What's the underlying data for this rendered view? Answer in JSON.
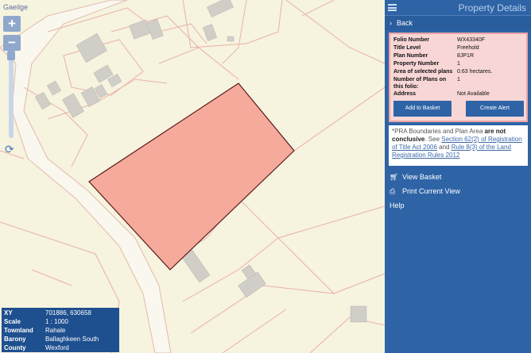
{
  "map": {
    "language_link": "Gaeilge",
    "zoom_in_label": "+",
    "zoom_out_label": "−",
    "selected_parcel_color": "#f5aa9c",
    "info": {
      "rows": [
        {
          "key": "XY",
          "value": "701886, 630658"
        },
        {
          "key": "Scale",
          "value": "1 : 1000"
        },
        {
          "key": "Townland",
          "value": "Rahale"
        },
        {
          "key": "Barony",
          "value": "Ballaghkeen South"
        },
        {
          "key": "County",
          "value": "Wexford"
        }
      ]
    }
  },
  "panel": {
    "title": "Property Details",
    "back_label": "Back",
    "details": [
      {
        "key": "Folio Number",
        "value": "WX43340F"
      },
      {
        "key": "Title Level",
        "value": "Freehold"
      },
      {
        "key": "Plan Number",
        "value": "8JP1R"
      },
      {
        "key": "Property Number",
        "value": "1"
      },
      {
        "key": "Area of selected plans",
        "value": "0.63 hectares."
      },
      {
        "key": "Number of Plans on this folio:",
        "value": "1"
      },
      {
        "key": "Address",
        "value": "Not Available"
      }
    ],
    "add_to_basket_label": "Add to Basket",
    "create_alert_label": "Create Alert",
    "note": {
      "prefix": "*PRA Boundaries and Plan Area ",
      "bold": "are not conclusive",
      "see": ". See ",
      "link1": "Section 62(2) of Registration of Title Act 2006",
      "and": " and ",
      "link2": "Rule 8(3) of the Land Registration Rules 2012"
    },
    "menu": {
      "view_basket": "View Basket",
      "print_current_view": "Print Current View",
      "help": "Help"
    },
    "accent_color": "#2e64a6"
  }
}
